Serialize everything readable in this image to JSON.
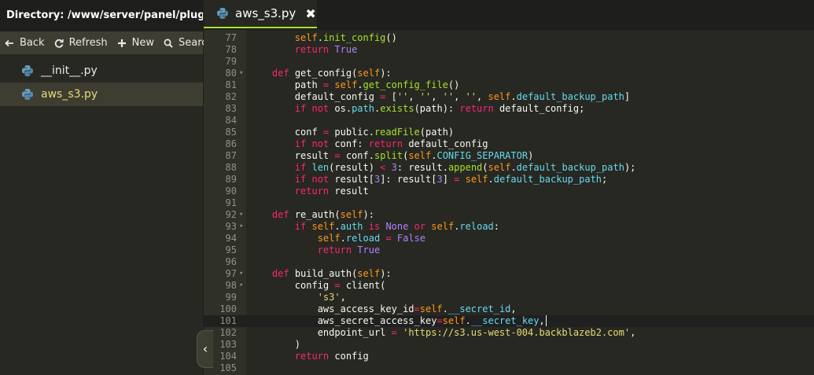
{
  "sidebar": {
    "directory": "Directory: /www/server/panel/plugin/a...",
    "toolbar": [
      {
        "label": "Back",
        "icon": "back-arrow-icon"
      },
      {
        "label": "Refresh",
        "icon": "refresh-icon"
      },
      {
        "label": "New",
        "icon": "plus-icon"
      },
      {
        "label": "Search",
        "icon": "search-icon"
      }
    ],
    "files": [
      {
        "name": "__init__.py",
        "icon": "python-icon",
        "active": false
      },
      {
        "name": "aws_s3.py",
        "icon": "python-icon",
        "active": true
      }
    ],
    "collapse": "‹"
  },
  "tab": {
    "title": "aws_s3.py",
    "close": "✖",
    "icon": "python-icon"
  },
  "colors": {
    "accent": "#a6e22e",
    "background": "#272822",
    "keyword": "#f92672",
    "string": "#e6db74",
    "self": "#fd971f",
    "function": "#a6e22e",
    "attribute": "#66d9ef",
    "number": "#ae81ff"
  },
  "editor": {
    "current_line": 101,
    "lines": [
      {
        "n": "77",
        "fold": "",
        "tokens": [
          [
            "txt",
            "        "
          ],
          [
            "self",
            "self"
          ],
          [
            "txt",
            "."
          ],
          [
            "fn",
            "init_config"
          ],
          [
            "txt",
            "()"
          ]
        ]
      },
      {
        "n": "78",
        "fold": "",
        "tokens": [
          [
            "txt",
            "        "
          ],
          [
            "kw",
            "return"
          ],
          [
            "txt",
            " "
          ],
          [
            "const",
            "True"
          ]
        ]
      },
      {
        "n": "79",
        "fold": "",
        "tokens": []
      },
      {
        "n": "80",
        "fold": "▾",
        "tokens": [
          [
            "txt",
            "    "
          ],
          [
            "kw",
            "def"
          ],
          [
            "txt",
            " get_config("
          ],
          [
            "self",
            "self"
          ],
          [
            "txt",
            "):"
          ]
        ]
      },
      {
        "n": "81",
        "fold": "",
        "tokens": [
          [
            "txt",
            "        path "
          ],
          [
            "op",
            "="
          ],
          [
            "txt",
            " "
          ],
          [
            "self",
            "self"
          ],
          [
            "txt",
            "."
          ],
          [
            "fn",
            "get_config_file"
          ],
          [
            "txt",
            "()"
          ]
        ]
      },
      {
        "n": "82",
        "fold": "",
        "tokens": [
          [
            "txt",
            "        default_config "
          ],
          [
            "op",
            "="
          ],
          [
            "txt",
            " ["
          ],
          [
            "str",
            "''"
          ],
          [
            "txt",
            ", "
          ],
          [
            "str",
            "''"
          ],
          [
            "txt",
            ", "
          ],
          [
            "str",
            "''"
          ],
          [
            "txt",
            ", "
          ],
          [
            "str",
            "''"
          ],
          [
            "txt",
            ", "
          ],
          [
            "self",
            "self"
          ],
          [
            "txt",
            "."
          ],
          [
            "attr",
            "default_backup_path"
          ],
          [
            "txt",
            "]"
          ]
        ]
      },
      {
        "n": "83",
        "fold": "",
        "tokens": [
          [
            "txt",
            "        "
          ],
          [
            "kw",
            "if"
          ],
          [
            "txt",
            " "
          ],
          [
            "kw",
            "not"
          ],
          [
            "txt",
            " os."
          ],
          [
            "attr",
            "path"
          ],
          [
            "txt",
            "."
          ],
          [
            "fn",
            "exists"
          ],
          [
            "txt",
            "(path): "
          ],
          [
            "kw",
            "return"
          ],
          [
            "txt",
            " default_config;"
          ]
        ]
      },
      {
        "n": "84",
        "fold": "",
        "tokens": []
      },
      {
        "n": "85",
        "fold": "",
        "tokens": [
          [
            "txt",
            "        conf "
          ],
          [
            "op",
            "="
          ],
          [
            "txt",
            " public."
          ],
          [
            "fn",
            "readFile"
          ],
          [
            "txt",
            "(path)"
          ]
        ]
      },
      {
        "n": "86",
        "fold": "",
        "tokens": [
          [
            "txt",
            "        "
          ],
          [
            "kw",
            "if"
          ],
          [
            "txt",
            " "
          ],
          [
            "kw",
            "not"
          ],
          [
            "txt",
            " conf: "
          ],
          [
            "kw",
            "return"
          ],
          [
            "txt",
            " default_config"
          ]
        ]
      },
      {
        "n": "87",
        "fold": "",
        "tokens": [
          [
            "txt",
            "        result "
          ],
          [
            "op",
            "="
          ],
          [
            "txt",
            " conf."
          ],
          [
            "fn",
            "split"
          ],
          [
            "txt",
            "("
          ],
          [
            "self",
            "self"
          ],
          [
            "txt",
            "."
          ],
          [
            "attr",
            "CONFIG_SEPARATOR"
          ],
          [
            "txt",
            ")"
          ]
        ]
      },
      {
        "n": "88",
        "fold": "",
        "tokens": [
          [
            "txt",
            "        "
          ],
          [
            "kw",
            "if"
          ],
          [
            "txt",
            " "
          ],
          [
            "attr",
            "len"
          ],
          [
            "txt",
            "(result) "
          ],
          [
            "op",
            "<"
          ],
          [
            "txt",
            " "
          ],
          [
            "num",
            "3"
          ],
          [
            "txt",
            ": result."
          ],
          [
            "fn",
            "append"
          ],
          [
            "txt",
            "("
          ],
          [
            "self",
            "self"
          ],
          [
            "txt",
            "."
          ],
          [
            "attr",
            "default_backup_path"
          ],
          [
            "txt",
            ");"
          ]
        ]
      },
      {
        "n": "89",
        "fold": "",
        "tokens": [
          [
            "txt",
            "        "
          ],
          [
            "kw",
            "if"
          ],
          [
            "txt",
            " "
          ],
          [
            "kw",
            "not"
          ],
          [
            "txt",
            " result["
          ],
          [
            "num",
            "3"
          ],
          [
            "txt",
            "]: result["
          ],
          [
            "num",
            "3"
          ],
          [
            "txt",
            "] "
          ],
          [
            "op",
            "="
          ],
          [
            "txt",
            " "
          ],
          [
            "self",
            "self"
          ],
          [
            "txt",
            "."
          ],
          [
            "attr",
            "default_backup_path"
          ],
          [
            "txt",
            ";"
          ]
        ]
      },
      {
        "n": "90",
        "fold": "",
        "tokens": [
          [
            "txt",
            "        "
          ],
          [
            "kw",
            "return"
          ],
          [
            "txt",
            " result"
          ]
        ]
      },
      {
        "n": "91",
        "fold": "",
        "tokens": []
      },
      {
        "n": "92",
        "fold": "▾",
        "tokens": [
          [
            "txt",
            "    "
          ],
          [
            "kw",
            "def"
          ],
          [
            "txt",
            " re_auth("
          ],
          [
            "self",
            "self"
          ],
          [
            "txt",
            "):"
          ]
        ]
      },
      {
        "n": "93",
        "fold": "▾",
        "tokens": [
          [
            "txt",
            "        "
          ],
          [
            "kw",
            "if"
          ],
          [
            "txt",
            " "
          ],
          [
            "self",
            "self"
          ],
          [
            "txt",
            "."
          ],
          [
            "attr",
            "auth"
          ],
          [
            "txt",
            " "
          ],
          [
            "kw",
            "is"
          ],
          [
            "txt",
            " "
          ],
          [
            "const",
            "None"
          ],
          [
            "txt",
            " "
          ],
          [
            "kw",
            "or"
          ],
          [
            "txt",
            " "
          ],
          [
            "self",
            "self"
          ],
          [
            "txt",
            "."
          ],
          [
            "attr",
            "reload"
          ],
          [
            "txt",
            ":"
          ]
        ]
      },
      {
        "n": "94",
        "fold": "",
        "tokens": [
          [
            "txt",
            "            "
          ],
          [
            "self",
            "self"
          ],
          [
            "txt",
            "."
          ],
          [
            "attr",
            "reload"
          ],
          [
            "txt",
            " "
          ],
          [
            "op",
            "="
          ],
          [
            "txt",
            " "
          ],
          [
            "const",
            "False"
          ]
        ]
      },
      {
        "n": "95",
        "fold": "",
        "tokens": [
          [
            "txt",
            "            "
          ],
          [
            "kw",
            "return"
          ],
          [
            "txt",
            " "
          ],
          [
            "const",
            "True"
          ]
        ]
      },
      {
        "n": "96",
        "fold": "",
        "tokens": []
      },
      {
        "n": "97",
        "fold": "▾",
        "tokens": [
          [
            "txt",
            "    "
          ],
          [
            "kw",
            "def"
          ],
          [
            "txt",
            " build_auth("
          ],
          [
            "self",
            "self"
          ],
          [
            "txt",
            "):"
          ]
        ]
      },
      {
        "n": "98",
        "fold": "▾",
        "tokens": [
          [
            "txt",
            "        config "
          ],
          [
            "op",
            "="
          ],
          [
            "txt",
            " client("
          ]
        ]
      },
      {
        "n": "99",
        "fold": "",
        "tokens": [
          [
            "txt",
            "            "
          ],
          [
            "str",
            "'s3'"
          ],
          [
            "txt",
            ","
          ]
        ]
      },
      {
        "n": "100",
        "fold": "",
        "tokens": [
          [
            "txt",
            "            aws_access_key_id"
          ],
          [
            "op",
            "="
          ],
          [
            "self",
            "self"
          ],
          [
            "txt",
            "."
          ],
          [
            "attr",
            "__secret_id"
          ],
          [
            "txt",
            ","
          ]
        ]
      },
      {
        "n": "101",
        "fold": "",
        "tokens": [
          [
            "txt",
            "            aws_secret_access_key"
          ],
          [
            "op",
            "="
          ],
          [
            "self",
            "self"
          ],
          [
            "txt",
            "."
          ],
          [
            "attr",
            "__secret_key"
          ],
          [
            "txt",
            ","
          ],
          [
            "caret",
            ""
          ]
        ]
      },
      {
        "n": "102",
        "fold": "",
        "tokens": [
          [
            "txt",
            "            endpoint_url "
          ],
          [
            "op",
            "="
          ],
          [
            "txt",
            " "
          ],
          [
            "str",
            "'https://s3.us-west-004.backblazeb2.com'"
          ],
          [
            "txt",
            ","
          ]
        ]
      },
      {
        "n": "103",
        "fold": "",
        "tokens": [
          [
            "txt",
            "        )"
          ]
        ]
      },
      {
        "n": "104",
        "fold": "",
        "tokens": [
          [
            "txt",
            "        "
          ],
          [
            "kw",
            "return"
          ],
          [
            "txt",
            " config"
          ]
        ]
      },
      {
        "n": "105",
        "fold": "",
        "tokens": []
      }
    ]
  }
}
